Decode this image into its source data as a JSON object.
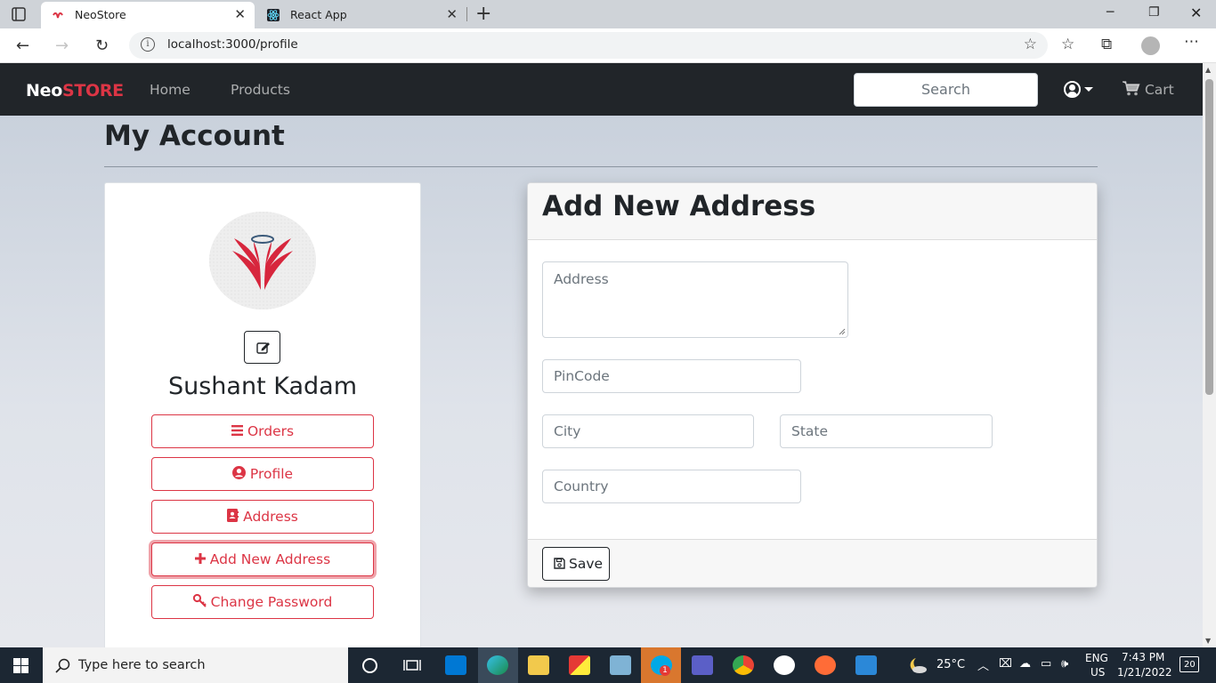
{
  "browser": {
    "tabs": [
      {
        "title": "NeoStore",
        "active": true
      },
      {
        "title": "React App",
        "active": false
      }
    ],
    "url": "localhost:3000/profile"
  },
  "navbar": {
    "brand_part1": "Neo",
    "brand_part2": "STORE",
    "links": [
      "Home",
      "Products"
    ],
    "search_placeholder": "Search",
    "cart_label": "Cart"
  },
  "page": {
    "title": "My Account"
  },
  "profile": {
    "name": "Sushant Kadam",
    "menu": [
      {
        "label": "Orders",
        "icon": "list-icon"
      },
      {
        "label": "Profile",
        "icon": "user-circle-icon"
      },
      {
        "label": "Address",
        "icon": "address-card-icon"
      },
      {
        "label": "Add New Address",
        "icon": "plus-icon"
      },
      {
        "label": "Change Password",
        "icon": "key-icon"
      }
    ]
  },
  "form": {
    "title": "Add New Address",
    "address_placeholder": "Address",
    "pincode_placeholder": "PinCode",
    "city_placeholder": "City",
    "state_placeholder": "State",
    "country_placeholder": "Country",
    "save_label": "Save"
  },
  "taskbar": {
    "search_placeholder": "Type here to search",
    "weather": "25°C",
    "lang_top": "ENG",
    "lang_bottom": "US",
    "time": "7:43 PM",
    "date": "1/21/2022",
    "notification_count": "20",
    "skype_badge": "1"
  },
  "colors": {
    "brand_red": "#dc3545",
    "navbar_bg": "#212529",
    "taskbar_bg": "#1c2733"
  }
}
